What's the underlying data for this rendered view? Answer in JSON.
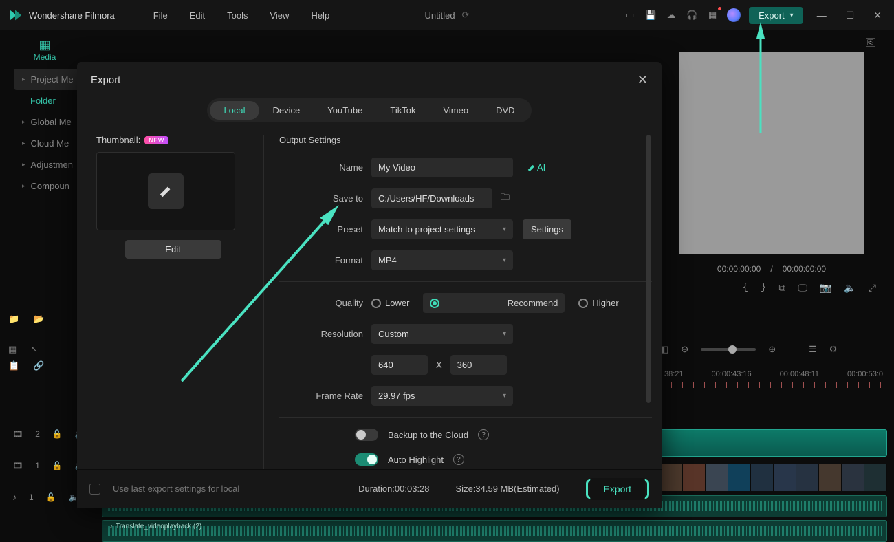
{
  "app": {
    "title": "Wondershare Filmora",
    "doc": "Untitled"
  },
  "menu": {
    "file": "File",
    "edit": "Edit",
    "tools": "Tools",
    "view": "View",
    "help": "Help"
  },
  "top": {
    "export": "Export"
  },
  "side": {
    "media": "Media",
    "project": "Project Me",
    "folder": "Folder",
    "global": "Global Me",
    "cloud": "Cloud Me",
    "adjust": "Adjustmen",
    "compound": "Compoun"
  },
  "preview": {
    "t1": "00:00:00:00",
    "t2": "00:00:00:00"
  },
  "ruler": {
    "a": "38:21",
    "b": "00:00:43:16",
    "c": "00:00:48:11",
    "d": "00:00:53:0"
  },
  "wave": {
    "name": "Translate_videoplayback (2)"
  },
  "dialog": {
    "title": "Export",
    "tabs": {
      "local": "Local",
      "device": "Device",
      "youtube": "YouTube",
      "tiktok": "TikTok",
      "vimeo": "Vimeo",
      "dvd": "DVD"
    },
    "thumbnail": "Thumbnail:",
    "new": "NEW",
    "edit": "Edit",
    "outSettings": "Output Settings",
    "name": "Name",
    "nameVal": "My Video",
    "saveTo": "Save to",
    "savePath": "C:/Users/HF/Downloads",
    "preset": "Preset",
    "presetVal": "Match to project settings",
    "settings": "Settings",
    "format": "Format",
    "formatVal": "MP4",
    "quality": "Quality",
    "q1": "Lower",
    "q2": "Recommend",
    "q3": "Higher",
    "resolution": "Resolution",
    "resVal": "Custom",
    "w": "640",
    "h": "360",
    "x": "X",
    "frame": "Frame Rate",
    "frameVal": "29.97 fps",
    "backup": "Backup to the Cloud",
    "autoHL": "Auto Highlight",
    "ai": "AI",
    "lastSettings": "Use last export settings for local",
    "duration": "Duration:00:03:28",
    "size": "Size:34.59 MB(Estimated)",
    "exportBtn": "Export"
  }
}
